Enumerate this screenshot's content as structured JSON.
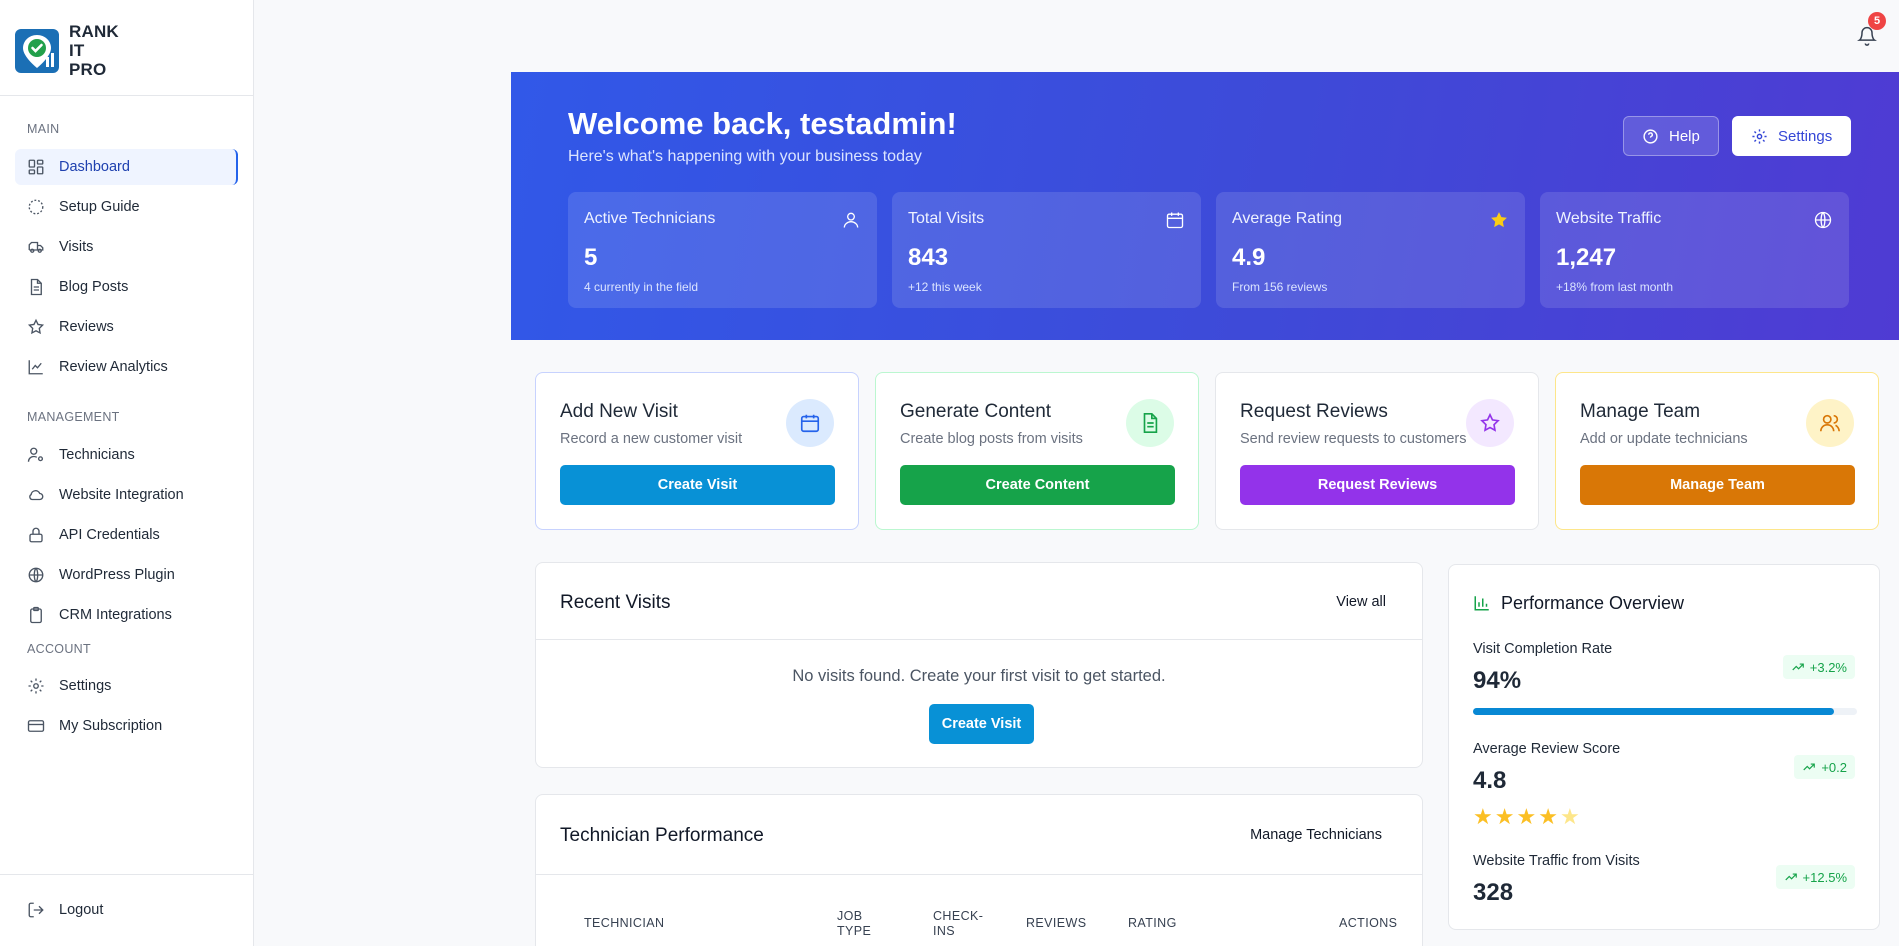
{
  "brand": {
    "name": "RANK\nIT\nPRO"
  },
  "sidebar": {
    "sections": {
      "main": "MAIN",
      "management": "MANAGEMENT",
      "account": "ACCOUNT"
    },
    "main_items": [
      {
        "label": "Dashboard",
        "icon": "dashboard-icon",
        "active": true
      },
      {
        "label": "Setup Guide",
        "icon": "setup-guide-icon"
      },
      {
        "label": "Visits",
        "icon": "truck-icon"
      },
      {
        "label": "Blog Posts",
        "icon": "document-icon"
      },
      {
        "label": "Reviews",
        "icon": "star-icon"
      },
      {
        "label": "Review Analytics",
        "icon": "line-chart-icon"
      }
    ],
    "management_items": [
      {
        "label": "Technicians",
        "icon": "user-cog-icon"
      },
      {
        "label": "Website Integration",
        "icon": "cloud-icon"
      },
      {
        "label": "API Credentials",
        "icon": "lock-icon"
      },
      {
        "label": "WordPress Plugin",
        "icon": "globe-icon"
      },
      {
        "label": "CRM Integrations",
        "icon": "clipboard-icon"
      }
    ],
    "account_items": [
      {
        "label": "Settings",
        "icon": "gear-icon"
      },
      {
        "label": "My Subscription",
        "icon": "credit-card-icon"
      }
    ],
    "logout": "Logout"
  },
  "topbar": {
    "notifications": "5"
  },
  "hero": {
    "title": "Welcome back, testadmin!",
    "subtitle": "Here's what's happening with your business today",
    "help": "Help",
    "settings": "Settings",
    "stats": [
      {
        "label": "Active Technicians",
        "value": "5",
        "note": "4 currently in the field",
        "icon": "user-icon"
      },
      {
        "label": "Total Visits",
        "value": "843",
        "note": "+12 this week",
        "icon": "calendar-icon"
      },
      {
        "label": "Average Rating",
        "value": "4.9",
        "note": "From 156 reviews",
        "icon": "star-icon"
      },
      {
        "label": "Website Traffic",
        "value": "1,247",
        "note": "+18% from last month",
        "icon": "globe-icon"
      }
    ]
  },
  "actions": [
    {
      "title": "Add New Visit",
      "desc": "Record a new customer visit",
      "button": "Create Visit",
      "color": "#0891d6",
      "border": "#c7d2fe",
      "circle": "#dbeafe",
      "icon_color": "#2563eb"
    },
    {
      "title": "Generate Content",
      "desc": "Create blog posts from visits",
      "button": "Create Content",
      "color": "#16a34a",
      "border": "#bbf7d0",
      "circle": "#dcfce7",
      "icon_color": "#16a34a"
    },
    {
      "title": "Request Reviews",
      "desc": "Send review requests to customers",
      "button": "Request Reviews",
      "color": "#9333ea",
      "border": "#e5e7eb",
      "circle": "#f3e8ff",
      "icon_color": "#9333ea"
    },
    {
      "title": "Manage Team",
      "desc": "Add or update technicians",
      "button": "Manage Team",
      "color": "#d97706",
      "border": "#fde68a",
      "circle": "#fef3c7",
      "icon_color": "#d97706"
    }
  ],
  "recent_visits": {
    "title": "Recent Visits",
    "view_all": "View all",
    "empty": "No visits found. Create your first visit to get started.",
    "button": "Create Visit"
  },
  "tech_perf": {
    "title": "Technician Performance",
    "manage": "Manage Technicians",
    "columns": [
      "TECHNICIAN",
      "JOB\nTYPE",
      "CHECK-\nINS",
      "REVIEWS",
      "RATING",
      "ACTIONS"
    ]
  },
  "performance": {
    "title": "Performance Overview",
    "metrics": [
      {
        "label": "Visit Completion Rate",
        "value": "94%",
        "change": "+3.2%",
        "progress": 0.94
      },
      {
        "label": "Average Review Score",
        "value": "4.8",
        "change": "+0.2",
        "stars": 4
      },
      {
        "label": "Website Traffic from Visits",
        "value": "328",
        "change": "+12.5%"
      }
    ]
  }
}
